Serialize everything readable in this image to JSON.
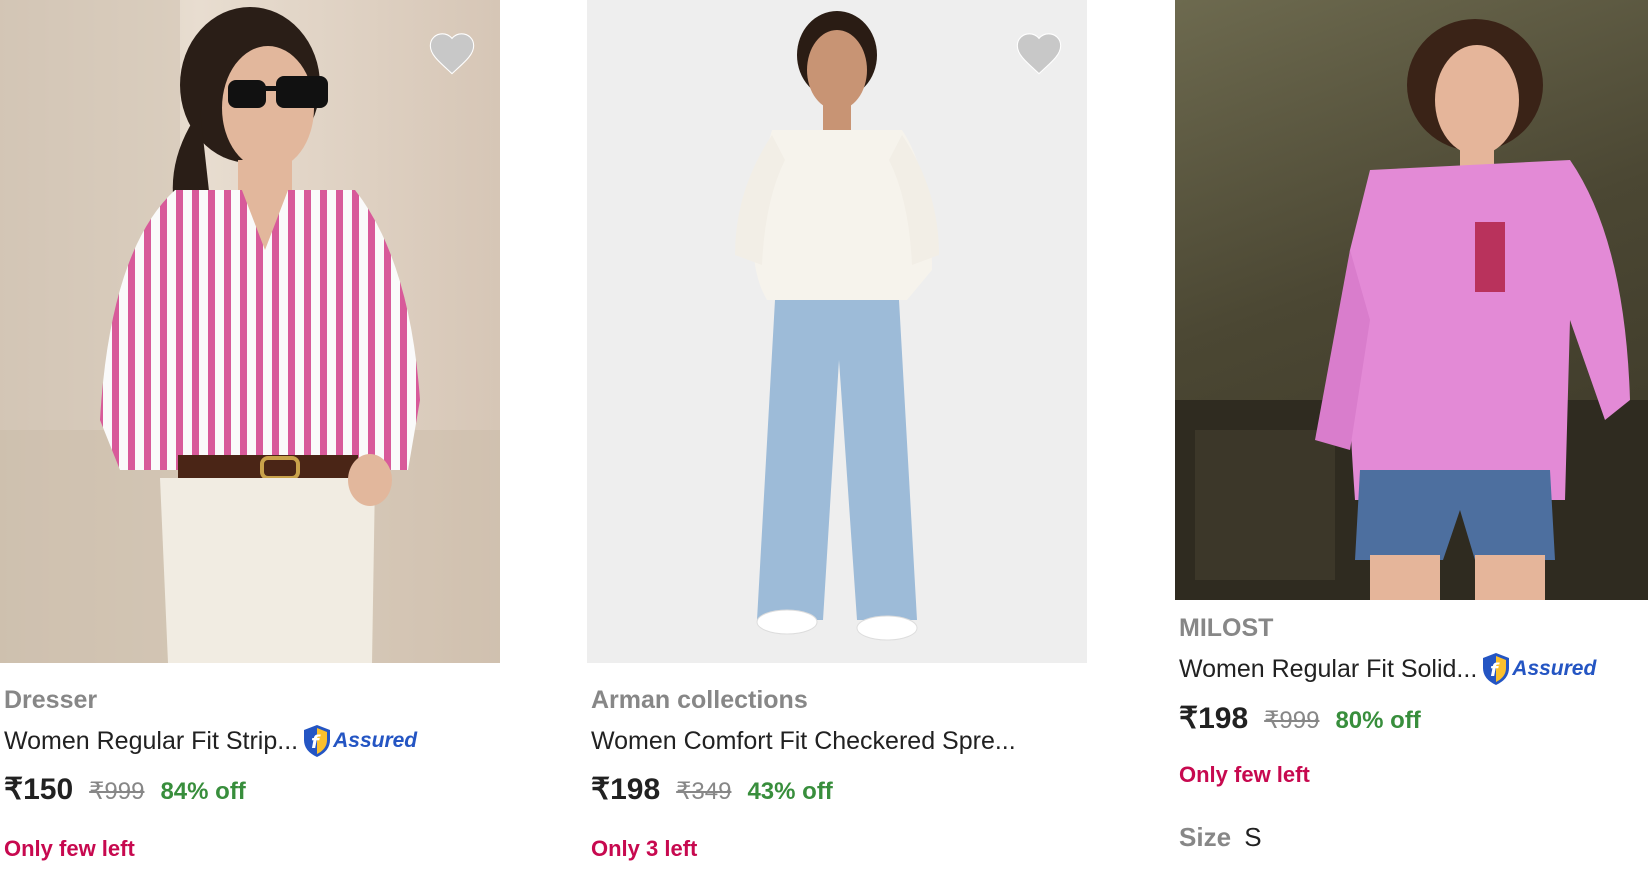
{
  "products": [
    {
      "brand": "Dresser",
      "title": "Women Regular Fit Strip...",
      "assured": true,
      "price": "₹150",
      "mrp": "₹999",
      "discount": "84% off",
      "stock": "Only few left",
      "wishlist_icon": "heart-icon"
    },
    {
      "brand": "Arman collections",
      "title": "Women Comfort Fit Checkered Spre...",
      "assured": false,
      "price": "₹198",
      "mrp": "₹349",
      "discount": "43% off",
      "stock": "Only 3 left",
      "wishlist_icon": "heart-icon"
    },
    {
      "brand": "MILOST",
      "title": "Women Regular Fit Solid...",
      "assured": true,
      "price": "₹198",
      "mrp": "₹999",
      "discount": "80% off",
      "stock": "Only few left",
      "size_label": "Size",
      "size_value": "S"
    }
  ],
  "assured_label": "Assured",
  "colors": {
    "brand_text": "#878787",
    "title_text": "#212121",
    "discount": "#388e3c",
    "stock": "#c7094f",
    "assured_blue": "#2455c3",
    "assured_badge": "#fbc02d"
  }
}
